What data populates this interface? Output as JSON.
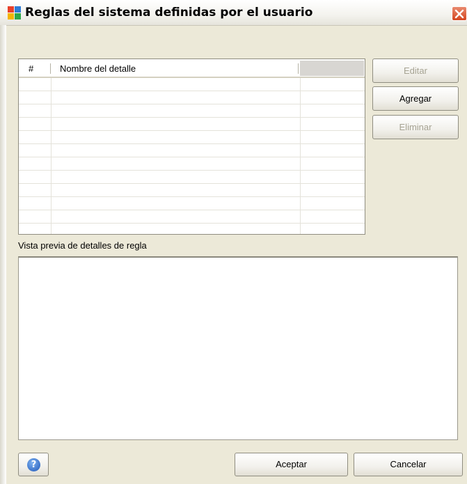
{
  "window": {
    "title": "Reglas del sistema definidas por el usuario"
  },
  "table": {
    "columns": [
      "#",
      "Nombre del detalle"
    ],
    "rows": []
  },
  "side_buttons": {
    "edit": "Editar",
    "add": "Agregar",
    "delete": "Eliminar"
  },
  "preview": {
    "label": "Vista previa de detalles de regla"
  },
  "footer": {
    "help_icon_glyph": "?",
    "ok": "Aceptar",
    "cancel": "Cancelar"
  },
  "colors": {
    "dialog_bg": "#ece9d8",
    "disabled_text": "#a6a393",
    "close_button": "#d4451f"
  }
}
